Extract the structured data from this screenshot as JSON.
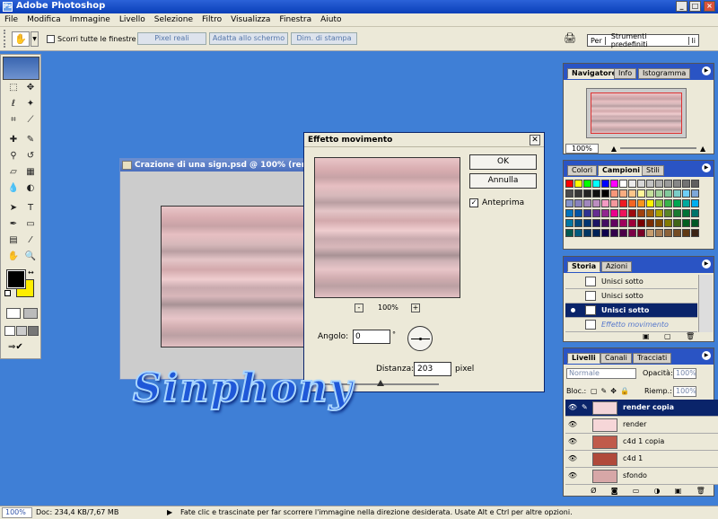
{
  "app": {
    "title": "Adobe Photoshop"
  },
  "menubar": [
    "File",
    "Modifica",
    "Immagine",
    "Livello",
    "Selezione",
    "Filtro",
    "Visualizza",
    "Finestra",
    "Aiuto"
  ],
  "options": {
    "scroll_all_label": "Scorri tutte le finestre",
    "btn_actual": "Pixel reali",
    "btn_fit": "Adatta allo schermo",
    "btn_print": "Dim. di stampa",
    "workspace": "Per",
    "presets": "Strumenti predefiniti",
    "li": "li"
  },
  "document": {
    "title": "Crazione di una sign.psd @ 100% (render c"
  },
  "dialog": {
    "title": "Effetto movimento",
    "ok": "OK",
    "cancel": "Annulla",
    "preview_label": "Anteprima",
    "preview_checked": true,
    "zoom_minus": "-",
    "zoom_plus": "+",
    "zoom": "100%",
    "angle_label": "Angolo:",
    "angle_value": "0",
    "angle_unit": "°",
    "distance_label": "Distanza:",
    "distance_value": "203",
    "distance_unit": "pixel"
  },
  "navigator": {
    "tabs": [
      "Navigatore",
      "Info",
      "Istogramma"
    ],
    "zoom": "100%"
  },
  "swatches": {
    "tabs": [
      "Colori",
      "Campioni",
      "Stili"
    ]
  },
  "history": {
    "tabs": [
      "Storia",
      "Azioni"
    ],
    "items": [
      {
        "label": "Unisci sotto",
        "selected": false
      },
      {
        "label": "Unisci sotto",
        "selected": false
      },
      {
        "label": "Unisci sotto",
        "selected": true
      },
      {
        "label": "Effetto movimento",
        "selected": false,
        "undone": true
      }
    ]
  },
  "layers": {
    "tabs": [
      "Livelli",
      "Canali",
      "Tracciati"
    ],
    "blend_mode": "Normale",
    "opacity_label": "Opacità:",
    "opacity": "100%",
    "lock_label": "Bloc.:",
    "fill_label": "Riemp.:",
    "fill": "100%",
    "items": [
      {
        "name": "render copia",
        "selected": true
      },
      {
        "name": "render",
        "selected": false
      },
      {
        "name": "c4d 1 copia",
        "selected": false
      },
      {
        "name": "c4d 1",
        "selected": false
      },
      {
        "name": "sfondo",
        "selected": false
      }
    ]
  },
  "status": {
    "zoom": "100%",
    "doc": "Doc: 234,4 KB/7,67 MB",
    "hint": "Fate clic e trascinate per far scorrere l'immagine nella direzione desiderata. Usate Alt e Ctrl per altre opzioni."
  },
  "watermark": "Sinphony",
  "colors": {
    "foreground": "#000000",
    "background": "#ffee00",
    "desktop": "#3f7fd6"
  }
}
